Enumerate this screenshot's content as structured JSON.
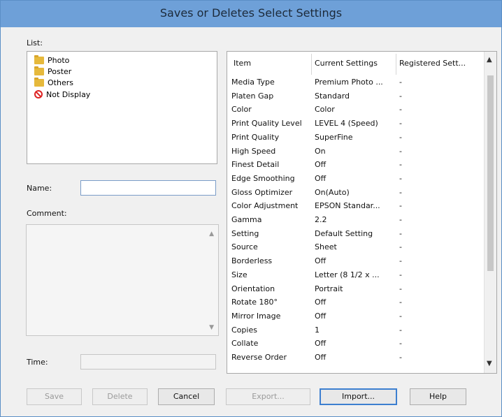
{
  "window": {
    "title": "Saves or Deletes Select Settings"
  },
  "left": {
    "list_label": "List:",
    "list_items": [
      {
        "label": "Photo",
        "icon": "folder-icon"
      },
      {
        "label": "Poster",
        "icon": "folder-icon"
      },
      {
        "label": "Others",
        "icon": "folder-icon"
      },
      {
        "label": "Not Display",
        "icon": "no-entry-icon"
      }
    ],
    "name_label": "Name:",
    "name_value": "",
    "comment_label": "Comment:",
    "comment_value": "",
    "time_label": "Time:",
    "time_value": ""
  },
  "table": {
    "headers": [
      "Item",
      "Current Settings",
      "Registered Sett..."
    ],
    "rows": [
      [
        "Media Type",
        "Premium Photo ...",
        "-"
      ],
      [
        "Platen Gap",
        "Standard",
        "-"
      ],
      [
        "Color",
        "Color",
        "-"
      ],
      [
        "Print Quality Level",
        "LEVEL 4 (Speed)",
        "-"
      ],
      [
        "Print Quality",
        "SuperFine",
        "-"
      ],
      [
        "High Speed",
        "On",
        "-"
      ],
      [
        "Finest Detail",
        "Off",
        "-"
      ],
      [
        "Edge Smoothing",
        "Off",
        "-"
      ],
      [
        "Gloss Optimizer",
        "On(Auto)",
        "-"
      ],
      [
        "Color Adjustment",
        "EPSON Standar...",
        "-"
      ],
      [
        "Gamma",
        "2.2",
        "-"
      ],
      [
        "Setting",
        "Default Setting",
        "-"
      ],
      [
        "Source",
        "Sheet",
        "-"
      ],
      [
        "Borderless",
        "Off",
        "-"
      ],
      [
        "Size",
        "Letter (8 1/2 x ...",
        "-"
      ],
      [
        "Orientation",
        "Portrait",
        "-"
      ],
      [
        "Rotate 180°",
        "Off",
        "-"
      ],
      [
        "Mirror Image",
        "Off",
        "-"
      ],
      [
        "Copies",
        "1",
        "-"
      ],
      [
        "Collate",
        "Off",
        "-"
      ],
      [
        "Reverse Order",
        "Off",
        "-"
      ]
    ]
  },
  "buttons": {
    "save": "Save",
    "delete": "Delete",
    "cancel": "Cancel",
    "export": "Export...",
    "import": "Import...",
    "help": "Help"
  },
  "colors": {
    "titlebar": "#6ea0d8",
    "accent": "#3c7fd0"
  }
}
